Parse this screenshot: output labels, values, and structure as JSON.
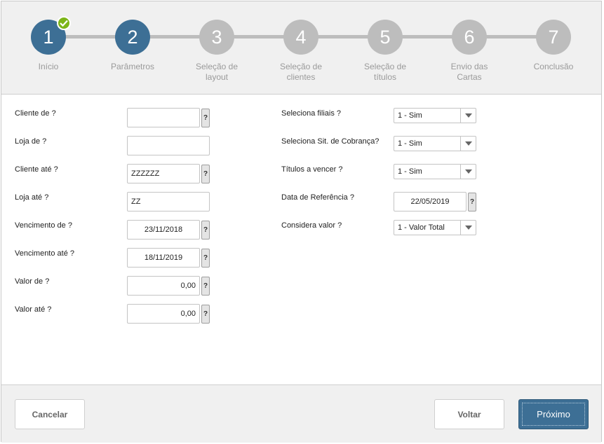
{
  "steps": [
    {
      "number": "1",
      "label": "Início",
      "state": "done"
    },
    {
      "number": "2",
      "label": "Parâmetros",
      "state": "active"
    },
    {
      "number": "3",
      "label": "Seleção de layout",
      "state": "pending"
    },
    {
      "number": "4",
      "label": "Seleção de clientes",
      "state": "pending"
    },
    {
      "number": "5",
      "label": "Seleção de títulos",
      "state": "pending"
    },
    {
      "number": "6",
      "label": "Envio das Cartas",
      "state": "pending"
    },
    {
      "number": "7",
      "label": "Conclusão",
      "state": "pending"
    }
  ],
  "left_fields": [
    {
      "label": "Cliente de ?",
      "value": "",
      "help": "?"
    },
    {
      "label": "Loja de ?",
      "value": ""
    },
    {
      "label": "Cliente até ?",
      "value": "ZZZZZZ",
      "help": "?"
    },
    {
      "label": "Loja até ?",
      "value": "ZZ"
    },
    {
      "label": "Vencimento de ?",
      "value": "23/11/2018",
      "help": "?"
    },
    {
      "label": "Vencimento até ?",
      "value": "18/11/2019",
      "help": "?"
    },
    {
      "label": "Valor de ?",
      "value": "0,00",
      "help": "?"
    },
    {
      "label": "Valor até ?",
      "value": "0,00",
      "help": "?"
    }
  ],
  "right_fields": [
    {
      "label": "Seleciona filiais ?",
      "value": "1 - Sim"
    },
    {
      "label": "Seleciona Sit. de Cobrança?",
      "value": "1 - Sim"
    },
    {
      "label": "Títulos a vencer ?",
      "value": "1 - Sim"
    },
    {
      "label": "Data de Referência ?",
      "value": "22/05/2019",
      "help": "?"
    },
    {
      "label": "Considera valor ?",
      "value": "1 - Valor Total"
    }
  ],
  "footer": {
    "cancel_label": "Cancelar",
    "back_label": "Voltar",
    "next_label": "Próximo"
  },
  "colors": {
    "active_step": "#3d6f95",
    "pending_step": "#bdbdbd",
    "check_badge": "#7cb518",
    "primary_button": "#3d6f95"
  },
  "icons": {
    "check": "check-icon",
    "dropdown": "chevron-down-icon"
  }
}
